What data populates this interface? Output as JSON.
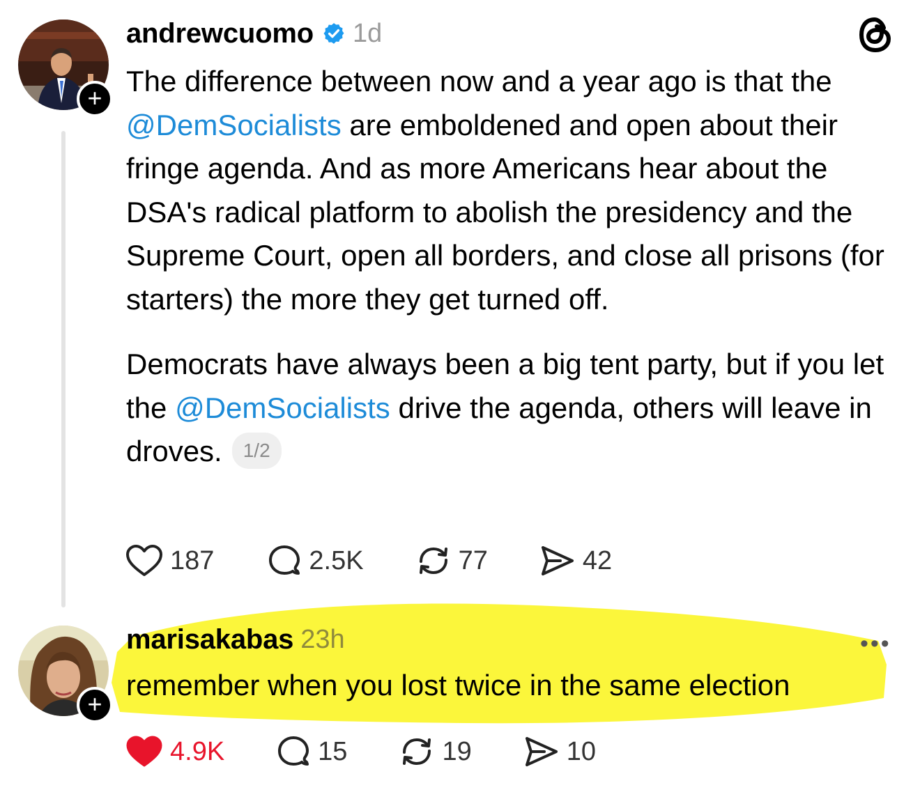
{
  "post": {
    "username": "andrewcuomo",
    "time": "1d",
    "paragraph1": {
      "before": "The difference between now and a year ago is that the ",
      "mention": "@DemSocialists",
      "after": " are emboldened and open about their fringe agenda. And as more Americans hear about the DSA's radical platform to abolish the presidency and the Supreme Court, open all borders, and close all prisons (for starters) the more they get turned off."
    },
    "paragraph2": {
      "before": "Democrats have always been a big tent party, but if you let the ",
      "mention": "@DemSocialists",
      "after": " drive the agenda, others will leave in droves."
    },
    "page_indicator": "1/2",
    "likes": "187",
    "replies": "2.5K",
    "reposts": "77",
    "shares": "42"
  },
  "reply": {
    "username": "marisakabas",
    "time": "23h",
    "text": "remember when you lost twice in the same election",
    "likes": "4.9K",
    "replies": "15",
    "reposts": "19",
    "shares": "10"
  },
  "colors": {
    "mention": "#1d8bd8",
    "verified": "#1d9bf0",
    "liked": "#e8142b",
    "highlight": "#fbf530"
  },
  "icons": [
    "threads-logo-icon",
    "verified-badge-icon",
    "heart-icon",
    "comment-icon",
    "repost-icon",
    "share-icon",
    "plus-icon",
    "more-icon"
  ]
}
